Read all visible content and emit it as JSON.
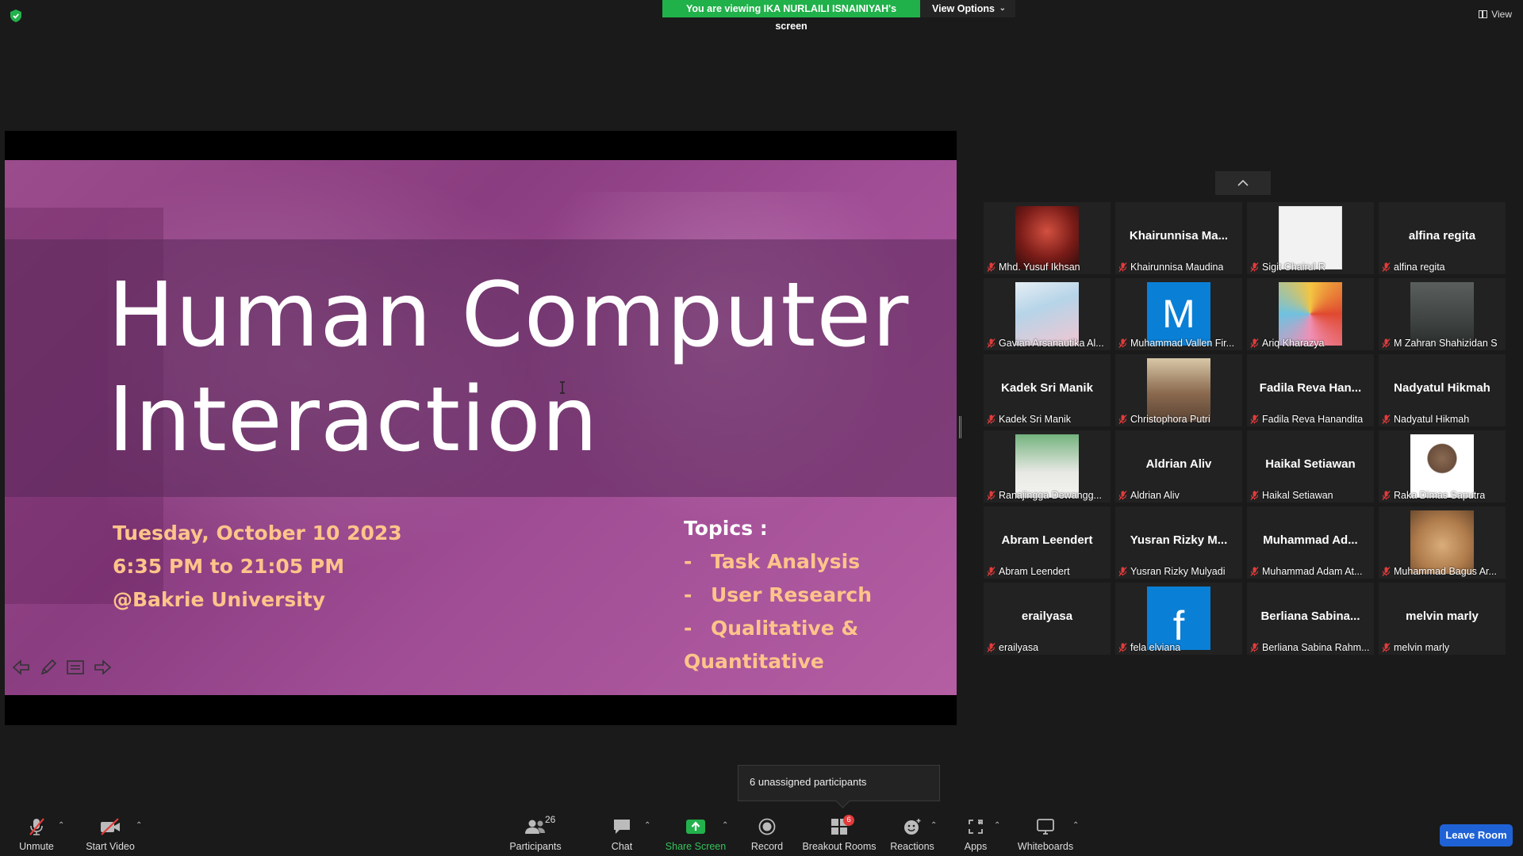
{
  "top": {
    "banner_text": "You are viewing IKA NURLAILI ISNAINIYAH's screen",
    "view_options_label": "View Options",
    "view_label": "View"
  },
  "slide": {
    "title_line1": "Human Computer",
    "title_line2": "Interaction",
    "date": "Tuesday, October 10 2023",
    "time": "6:35 PM to 21:05 PM",
    "location": "@Bakrie University",
    "topics_header": "Topics :",
    "topics": [
      "Task Analysis",
      "User Research",
      "Qualitative & Quantitative"
    ],
    "topic_dash": "-"
  },
  "gallery": {
    "tiles": [
      {
        "display": "",
        "name": "Mhd. Yusuf Ikhsan",
        "photo": "red-costume-avatar"
      },
      {
        "display": "Khairunnisa  Ma...",
        "name": "Khairunnisa Maudina",
        "photo": ""
      },
      {
        "display": "",
        "name": "Sigit Chairul R",
        "photo": "samurai-sketch-avatar"
      },
      {
        "display": "alfina regita",
        "name": "alfina regita",
        "photo": ""
      },
      {
        "display": "",
        "name": "Gavian Arsanautika Al...",
        "photo": "anime-avatar"
      },
      {
        "display": "",
        "name": "Muhammad Vallen Fir...",
        "photo": "letter-m-avatar",
        "letter": "M"
      },
      {
        "display": "",
        "name": "Ariq Kharazya",
        "photo": "colorful-art-avatar"
      },
      {
        "display": "",
        "name": "M Zahran Shahizidan S",
        "photo": "dark-figure-avatar"
      },
      {
        "display": "Kadek Sri Manik",
        "name": "Kadek Sri Manik",
        "photo": ""
      },
      {
        "display": "",
        "name": "Christophora Putri",
        "photo": "group-photo-avatar"
      },
      {
        "display": "Fadila Reva Han...",
        "name": "Fadila Reva Hanandita",
        "photo": ""
      },
      {
        "display": "Nadyatul Hikmah",
        "name": "Nadyatul Hikmah",
        "photo": ""
      },
      {
        "display": "",
        "name": "Ranajingga Dewangg...",
        "photo": "hijab-portrait-avatar"
      },
      {
        "display": "Aldrian Aliv",
        "name": "Aldrian Aliv",
        "photo": ""
      },
      {
        "display": "Haikal Setiawan",
        "name": "Haikal Setiawan",
        "photo": ""
      },
      {
        "display": "",
        "name": "Raka Dimas Saputra",
        "photo": "formal-portrait-avatar"
      },
      {
        "display": "Abram Leendert",
        "name": "Abram Leendert",
        "photo": ""
      },
      {
        "display": "Yusran Rizky  M...",
        "name": "Yusran Rizky Mulyadi",
        "photo": ""
      },
      {
        "display": "Muhammad  Ad...",
        "name": "Muhammad Adam At...",
        "photo": ""
      },
      {
        "display": "",
        "name": "Muhammad Bagus Ar...",
        "photo": "cat-avatar"
      },
      {
        "display": "erailyasa",
        "name": "erailyasa",
        "photo": ""
      },
      {
        "display": "",
        "name": "fela elviana",
        "photo": "letter-f-avatar",
        "letter": "f"
      },
      {
        "display": "Berliana  Sabina...",
        "name": "Berliana Sabina Rahm...",
        "photo": ""
      },
      {
        "display": "melvin marly",
        "name": "melvin marly",
        "photo": ""
      }
    ]
  },
  "toast": {
    "text": "6 unassigned participants"
  },
  "toolbar": {
    "unmute": "Unmute",
    "start_video": "Start Video",
    "participants": "Participants",
    "participants_count": "26",
    "chat": "Chat",
    "share_screen": "Share Screen",
    "record": "Record",
    "breakout_rooms": "Breakout Rooms",
    "breakout_badge": "6",
    "reactions": "Reactions",
    "apps": "Apps",
    "whiteboards": "Whiteboards",
    "leave_room": "Leave Room"
  },
  "colors": {
    "banner_green": "#20b14a",
    "leave_blue": "#1f62d6",
    "slide_accent": "#ffc48a",
    "muted_red": "#e23b3b"
  }
}
